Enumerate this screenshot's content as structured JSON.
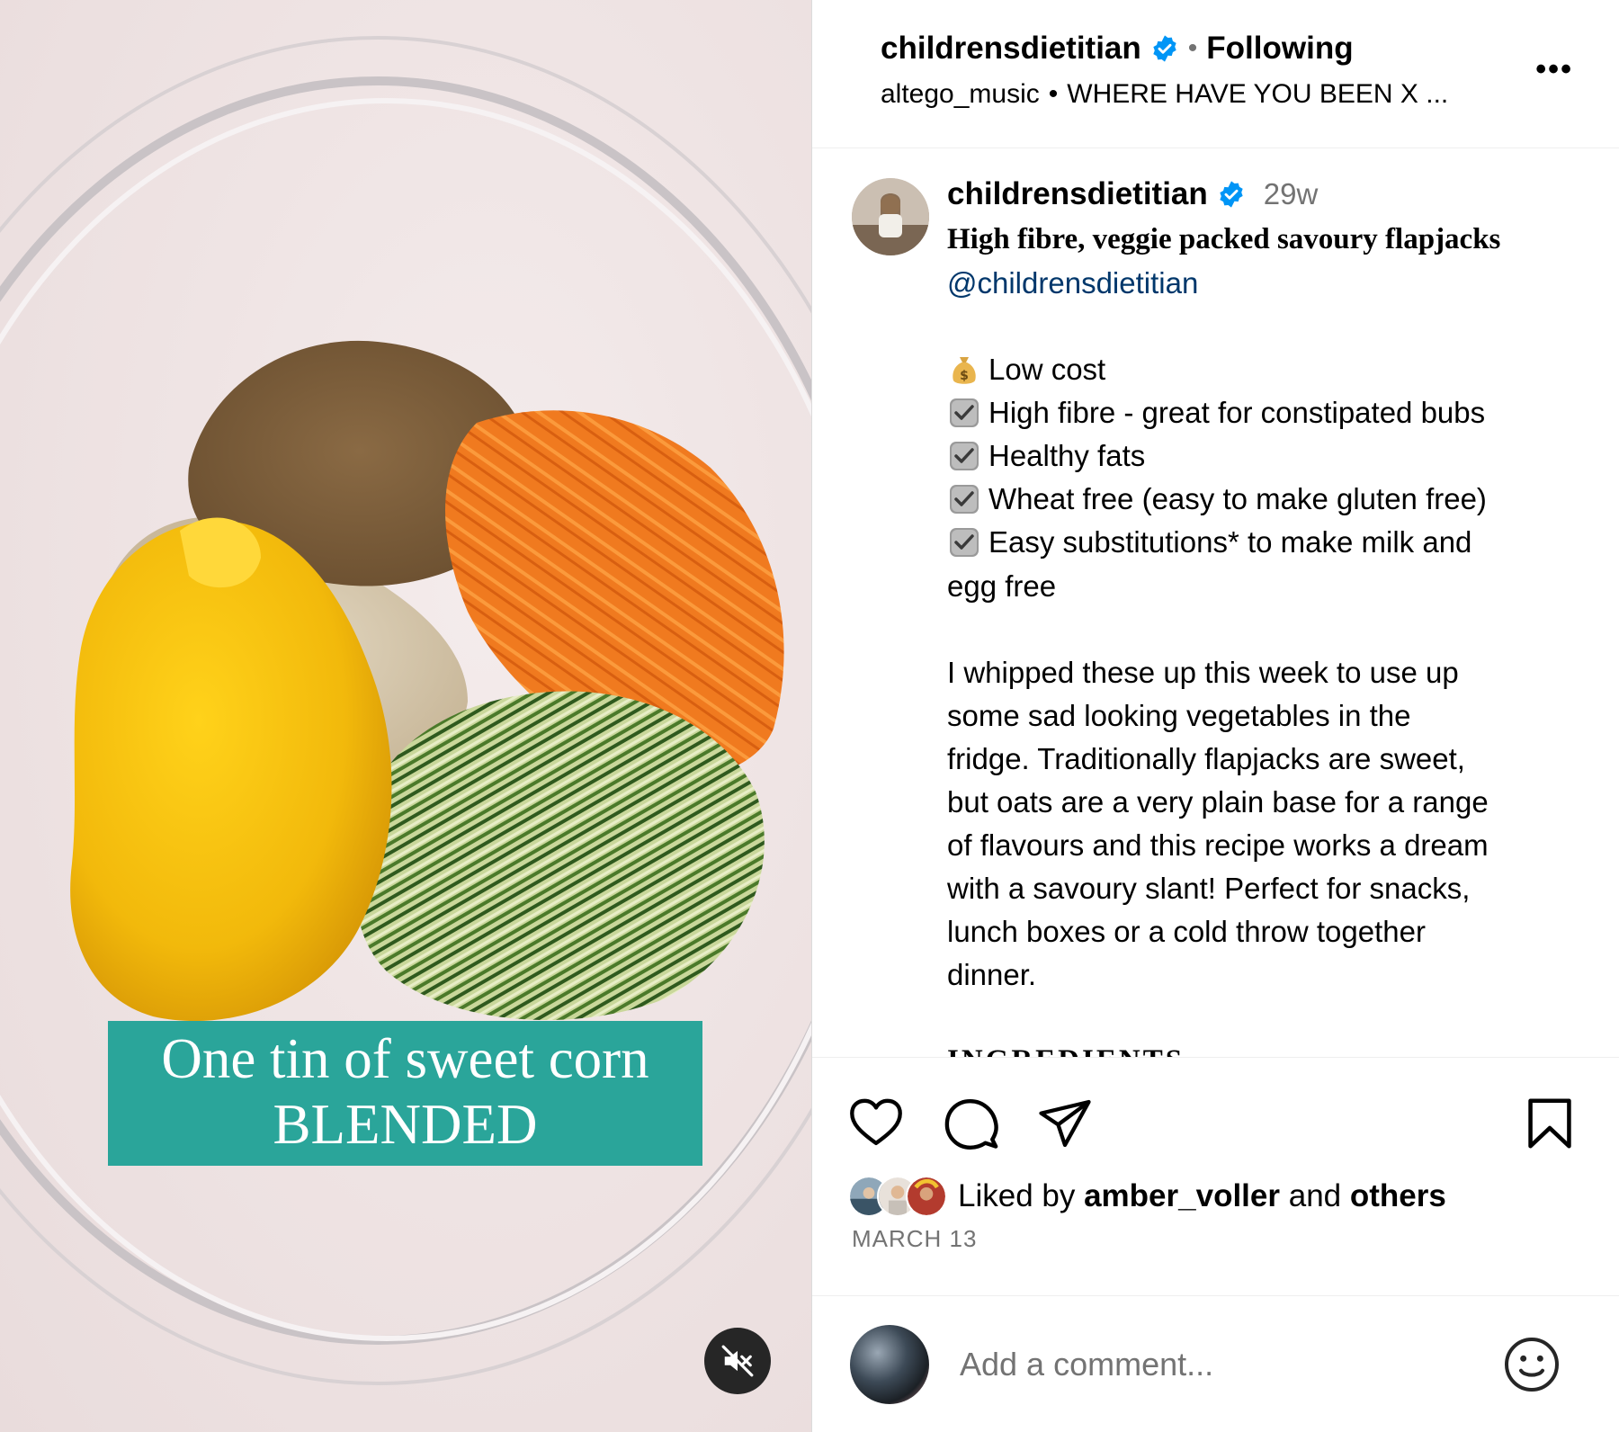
{
  "media": {
    "overlay_lines": [
      "One tin of sweet corn",
      "BLENDED"
    ],
    "mute_icon": "speaker-muted-icon"
  },
  "header": {
    "username": "childrensdietitian",
    "separator": "•",
    "follow_status": "Following",
    "audio_artist": "altego_music",
    "audio_separator": "•",
    "audio_track": "WHERE HAVE YOU BEEN X ...",
    "more_label": "•••"
  },
  "caption": {
    "username": "childrensdietitian",
    "age": "29w",
    "title": "High fibre, veggie packed savoury flapjacks",
    "mention": "@childrensdietitian",
    "bullets": [
      {
        "icon": "money-bag-icon",
        "text": "Low cost"
      },
      {
        "icon": "check-box-icon",
        "text": "High fibre - great for constipated bubs"
      },
      {
        "icon": "check-box-icon",
        "text": "Healthy fats"
      },
      {
        "icon": "check-box-icon",
        "text": "Wheat free (easy to make gluten free)"
      },
      {
        "icon": "check-box-icon",
        "text": "Easy substitutions* to make milk and"
      }
    ],
    "bullet_continuation": "egg free",
    "paragraph": [
      "I whipped these up this week to use up",
      "some sad looking vegetables in the",
      "fridge. Traditionally flapjacks are sweet,",
      "but oats are a very plain base for a range",
      "of flavours and this recipe works a dream",
      "with a savoury slant! Perfect for snacks,",
      "lunch boxes or a cold throw together",
      "dinner."
    ],
    "next_heading": "INGREDIENTS"
  },
  "actions": {
    "like_icon": "heart-icon",
    "comment_icon": "comment-icon",
    "share_icon": "paper-plane-icon",
    "save_icon": "bookmark-icon"
  },
  "likes": {
    "prefix": "Liked by ",
    "user": "amber_voller",
    "middle": " and ",
    "others": "others"
  },
  "date": "MARCH 13",
  "comment": {
    "placeholder": "Add a comment...",
    "emoji_icon": "smiley-icon"
  },
  "colors": {
    "verified_blue": "#0095f6",
    "overlay_teal": "#2aa59a",
    "link_blue": "#00376b",
    "muted_text": "#737373"
  }
}
